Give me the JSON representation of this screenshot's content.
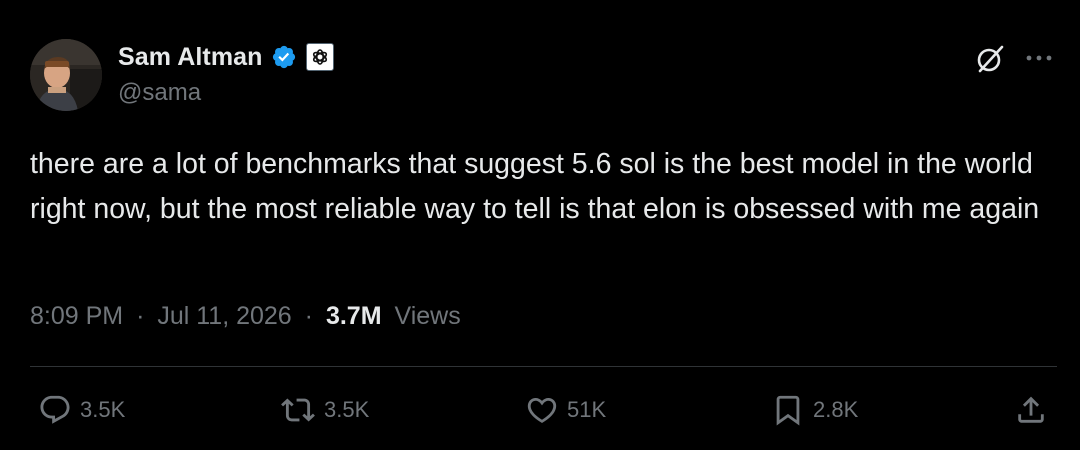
{
  "author": {
    "display_name": "Sam Altman",
    "handle": "@sama",
    "verified": true,
    "affiliate": "OpenAI"
  },
  "tweet": {
    "text": "there are a lot of benchmarks that suggest 5.6 sol is the best model in the world right now, but the most reliable way to tell is that elon is obsessed with me again",
    "time": "8:09 PM",
    "separator": "·",
    "date": "Jul 11, 2026",
    "views_count": "3.7M",
    "views_label": "Views"
  },
  "actions": {
    "reply_count": "3.5K",
    "repost_count": "3.5K",
    "like_count": "51K",
    "bookmark_count": "2.8K"
  },
  "icons": {
    "verified": "verified-check-icon",
    "affiliate": "openai-logo-icon",
    "grok": "grok-icon",
    "more": "more-horizontal-icon",
    "reply": "reply-icon",
    "repost": "repost-icon",
    "like": "heart-icon",
    "bookmark": "bookmark-icon",
    "share": "share-icon"
  },
  "colors": {
    "background": "#000000",
    "text_primary": "#e7e9ea",
    "text_secondary": "#71767b",
    "verified_blue": "#1d9bf0",
    "divider": "#2f3336"
  }
}
